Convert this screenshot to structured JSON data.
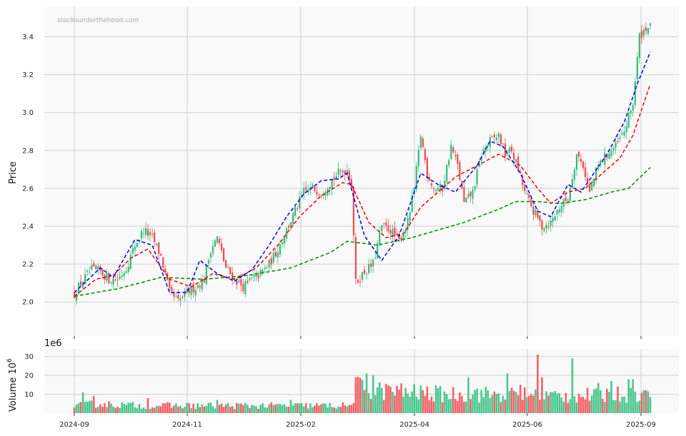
{
  "chart_data": {
    "type": "candlestick",
    "watermark": "stocksunderthehood.com",
    "ylabel": "Price",
    "ylim": [
      1.82,
      3.56
    ],
    "yticks": [
      "2.0",
      "2.2",
      "2.4",
      "2.6",
      "2.8",
      "3.0",
      "3.2",
      "3.4"
    ],
    "ytick_values": [
      2.0,
      2.2,
      2.4,
      2.6,
      2.8,
      3.0,
      3.2,
      3.4
    ],
    "xticks": [
      "2024-09",
      "2024-11",
      "2025-02",
      "2025-04",
      "2025-06",
      "2025-09"
    ],
    "grid": true,
    "colors": {
      "up": "#2ebd7a",
      "down": "#f0484d",
      "ma_fast": "#0000ee",
      "ma_mid": "#ee0000",
      "ma_slow": "#008800",
      "panel_bg": "#f9f9f9",
      "grid": "#d0d0d0"
    },
    "price_anchors": [
      [
        0,
        2.04
      ],
      [
        3,
        2.1
      ],
      [
        8,
        2.17
      ],
      [
        12,
        2.16
      ],
      [
        16,
        2.12
      ],
      [
        20,
        2.12
      ],
      [
        24,
        2.18
      ],
      [
        28,
        2.3
      ],
      [
        32,
        2.38
      ],
      [
        36,
        2.34
      ],
      [
        40,
        2.24
      ],
      [
        44,
        2.05
      ],
      [
        48,
        2.0
      ],
      [
        52,
        2.05
      ],
      [
        56,
        2.08
      ],
      [
        60,
        2.12
      ],
      [
        63,
        2.28
      ],
      [
        66,
        2.34
      ],
      [
        70,
        2.18
      ],
      [
        74,
        2.12
      ],
      [
        78,
        2.08
      ],
      [
        82,
        2.12
      ],
      [
        86,
        2.15
      ],
      [
        90,
        2.2
      ],
      [
        94,
        2.28
      ],
      [
        98,
        2.38
      ],
      [
        102,
        2.48
      ],
      [
        106,
        2.58
      ],
      [
        110,
        2.6
      ],
      [
        114,
        2.58
      ],
      [
        118,
        2.63
      ],
      [
        122,
        2.68
      ],
      [
        126,
        2.7
      ],
      [
        128,
        2.62
      ],
      [
        130,
        2.1
      ],
      [
        134,
        2.16
      ],
      [
        138,
        2.2
      ],
      [
        142,
        2.4
      ],
      [
        146,
        2.38
      ],
      [
        150,
        2.32
      ],
      [
        154,
        2.42
      ],
      [
        157,
        2.6
      ],
      [
        160,
        2.88
      ],
      [
        163,
        2.68
      ],
      [
        166,
        2.6
      ],
      [
        170,
        2.6
      ],
      [
        174,
        2.82
      ],
      [
        177,
        2.72
      ],
      [
        180,
        2.52
      ],
      [
        184,
        2.58
      ],
      [
        188,
        2.78
      ],
      [
        192,
        2.85
      ],
      [
        196,
        2.88
      ],
      [
        199,
        2.78
      ],
      [
        202,
        2.8
      ],
      [
        205,
        2.7
      ],
      [
        208,
        2.58
      ],
      [
        212,
        2.48
      ],
      [
        216,
        2.4
      ],
      [
        220,
        2.42
      ],
      [
        224,
        2.5
      ],
      [
        228,
        2.55
      ],
      [
        232,
        2.78
      ],
      [
        235,
        2.72
      ],
      [
        238,
        2.58
      ],
      [
        242,
        2.72
      ],
      [
        246,
        2.78
      ],
      [
        250,
        2.82
      ],
      [
        254,
        2.9
      ],
      [
        258,
        3.05
      ],
      [
        261,
        3.4
      ],
      [
        264,
        3.45
      ]
    ],
    "ma_fast": [
      [
        0,
        2.05
      ],
      [
        12,
        2.18
      ],
      [
        18,
        2.13
      ],
      [
        28,
        2.33
      ],
      [
        36,
        2.3
      ],
      [
        44,
        2.05
      ],
      [
        52,
        2.05
      ],
      [
        58,
        2.22
      ],
      [
        66,
        2.15
      ],
      [
        74,
        2.11
      ],
      [
        82,
        2.17
      ],
      [
        90,
        2.3
      ],
      [
        98,
        2.45
      ],
      [
        106,
        2.57
      ],
      [
        114,
        2.64
      ],
      [
        122,
        2.65
      ],
      [
        126,
        2.68
      ],
      [
        134,
        2.35
      ],
      [
        142,
        2.22
      ],
      [
        150,
        2.35
      ],
      [
        160,
        2.68
      ],
      [
        168,
        2.62
      ],
      [
        176,
        2.58
      ],
      [
        186,
        2.72
      ],
      [
        192,
        2.85
      ],
      [
        198,
        2.82
      ],
      [
        206,
        2.68
      ],
      [
        214,
        2.48
      ],
      [
        220,
        2.45
      ],
      [
        228,
        2.62
      ],
      [
        234,
        2.58
      ],
      [
        246,
        2.78
      ],
      [
        254,
        2.95
      ],
      [
        260,
        3.15
      ],
      [
        266,
        3.32
      ]
    ],
    "ma_mid": [
      [
        0,
        2.03
      ],
      [
        10,
        2.12
      ],
      [
        18,
        2.14
      ],
      [
        26,
        2.23
      ],
      [
        34,
        2.28
      ],
      [
        44,
        2.12
      ],
      [
        54,
        2.08
      ],
      [
        64,
        2.15
      ],
      [
        74,
        2.12
      ],
      [
        84,
        2.18
      ],
      [
        94,
        2.3
      ],
      [
        104,
        2.45
      ],
      [
        114,
        2.56
      ],
      [
        124,
        2.63
      ],
      [
        128,
        2.62
      ],
      [
        136,
        2.42
      ],
      [
        144,
        2.34
      ],
      [
        152,
        2.36
      ],
      [
        160,
        2.5
      ],
      [
        168,
        2.58
      ],
      [
        176,
        2.66
      ],
      [
        186,
        2.72
      ],
      [
        196,
        2.78
      ],
      [
        206,
        2.72
      ],
      [
        214,
        2.6
      ],
      [
        220,
        2.52
      ],
      [
        228,
        2.58
      ],
      [
        236,
        2.6
      ],
      [
        244,
        2.68
      ],
      [
        252,
        2.76
      ],
      [
        258,
        2.88
      ],
      [
        266,
        3.15
      ]
    ],
    "ma_slow": [
      [
        0,
        2.03
      ],
      [
        20,
        2.07
      ],
      [
        40,
        2.13
      ],
      [
        60,
        2.12
      ],
      [
        80,
        2.14
      ],
      [
        100,
        2.18
      ],
      [
        118,
        2.26
      ],
      [
        126,
        2.32
      ],
      [
        140,
        2.3
      ],
      [
        156,
        2.34
      ],
      [
        168,
        2.38
      ],
      [
        180,
        2.42
      ],
      [
        196,
        2.49
      ],
      [
        204,
        2.53
      ],
      [
        214,
        2.53
      ],
      [
        224,
        2.52
      ],
      [
        236,
        2.54
      ],
      [
        248,
        2.58
      ],
      [
        256,
        2.6
      ],
      [
        266,
        2.71
      ]
    ],
    "volume": {
      "ylabel": "Volume  10",
      "ylabel_exponent": "6",
      "offset_text": "1e6",
      "ylim": [
        0,
        34
      ],
      "yticks": [
        "10",
        "20",
        "30"
      ],
      "ytick_values": [
        10,
        20,
        30
      ],
      "levels": [
        [
          0,
          4
        ],
        [
          10,
          5
        ],
        [
          30,
          4
        ],
        [
          60,
          4
        ],
        [
          80,
          4
        ],
        [
          110,
          4
        ],
        [
          128,
          4
        ],
        [
          130,
          14
        ],
        [
          140,
          12
        ],
        [
          170,
          10
        ],
        [
          200,
          10
        ],
        [
          230,
          9
        ],
        [
          250,
          10
        ],
        [
          266,
          10
        ]
      ],
      "spikes": [
        [
          4,
          11
        ],
        [
          9,
          9
        ],
        [
          34,
          8
        ],
        [
          66,
          7
        ],
        [
          100,
          7
        ],
        [
          130,
          19
        ],
        [
          135,
          21
        ],
        [
          138,
          20
        ],
        [
          146,
          14
        ],
        [
          178,
          11
        ],
        [
          182,
          19
        ],
        [
          186,
          13
        ],
        [
          200,
          21
        ],
        [
          206,
          15
        ],
        [
          214,
          31
        ],
        [
          216,
          19
        ],
        [
          230,
          29
        ],
        [
          242,
          16
        ],
        [
          248,
          17
        ],
        [
          256,
          18
        ],
        [
          258,
          18
        ]
      ]
    },
    "n_bars": 267
  }
}
